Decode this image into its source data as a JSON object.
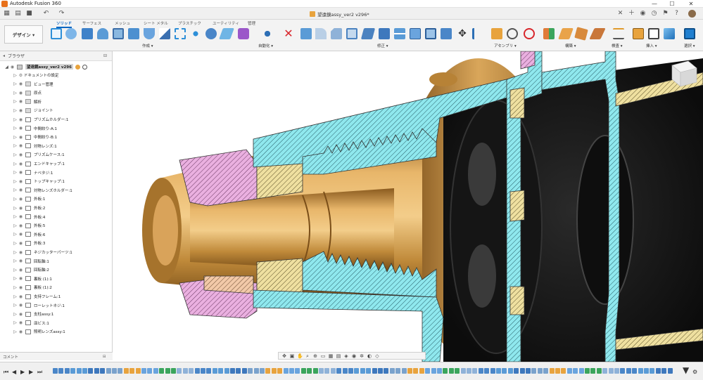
{
  "titlebar": {
    "app_title": "Autodesk Fusion 360",
    "minimize": "—",
    "maximize": "☐",
    "close": "✕"
  },
  "document": {
    "tab_title": "望遠鏡assy_ver2 v296*"
  },
  "workspace": {
    "design_label": "デザイン ▾"
  },
  "tabs": [
    {
      "label": "ソリッド",
      "active": true
    },
    {
      "label": "サーフェス"
    },
    {
      "label": "メッシュ"
    },
    {
      "label": "シート メタル"
    },
    {
      "label": "プラスチック"
    },
    {
      "label": "ユーティリティ"
    },
    {
      "label": "管理"
    }
  ],
  "groups": {
    "create": "作成 ▾",
    "automate": "自動化 ▾",
    "modify": "修正 ▾",
    "assemble": "アセンブリ ▾",
    "construct": "構築 ▾",
    "inspect": "検査 ▾",
    "insert": "挿入 ▾",
    "select": "選択 ▾"
  },
  "browser": {
    "title": "ブラウザ",
    "root": "望遠鏡assy_ver2 v296",
    "items": [
      {
        "label": "ドキュメントの設定",
        "kind": "gear"
      },
      {
        "label": "ビュー管理",
        "kind": "folder"
      },
      {
        "label": "原点",
        "kind": "folder"
      },
      {
        "label": "解析",
        "kind": "folder"
      },
      {
        "label": "ジョイント",
        "kind": "folder"
      },
      {
        "label": "プリズムホルダー:1",
        "kind": "comp"
      },
      {
        "label": "中間絞り-A:1",
        "kind": "comp"
      },
      {
        "label": "中間絞り-B:1",
        "kind": "comp"
      },
      {
        "label": "対物レンズ:1",
        "kind": "comp"
      },
      {
        "label": "プリズムケース:1",
        "kind": "comp"
      },
      {
        "label": "エンドキャップ:1",
        "kind": "comp"
      },
      {
        "label": "ナベタジ:1",
        "kind": "link"
      },
      {
        "label": "トップキャップ:1",
        "kind": "comp"
      },
      {
        "label": "対物レンズホルダー:1",
        "kind": "comp"
      },
      {
        "label": "外板:1",
        "kind": "comp"
      },
      {
        "label": "外板:2",
        "kind": "comp"
      },
      {
        "label": "外板:4",
        "kind": "comp"
      },
      {
        "label": "外板:5",
        "kind": "comp"
      },
      {
        "label": "外板:6",
        "kind": "comp"
      },
      {
        "label": "外板:3",
        "kind": "comp"
      },
      {
        "label": "ネジカッターパーツ:1",
        "kind": "link"
      },
      {
        "label": "回転軸:1",
        "kind": "comp"
      },
      {
        "label": "回転軸:2",
        "kind": "comp"
      },
      {
        "label": "裏板 (1):1",
        "kind": "comp"
      },
      {
        "label": "裏板 (1):2",
        "kind": "comp"
      },
      {
        "label": "支持フレーム:1",
        "kind": "comp"
      },
      {
        "label": "ローレットネジ:1",
        "kind": "comp"
      },
      {
        "label": "支柱assy:1",
        "kind": "link"
      },
      {
        "label": "皿ビス:1",
        "kind": "comp"
      },
      {
        "label": "照明レンズassy:1",
        "kind": "link"
      }
    ]
  },
  "comments": {
    "title": "コメント"
  },
  "colors": {
    "accent": "#0a66c2",
    "brass": "#c8923c",
    "section_cyan": "#8fe8ee",
    "section_pink": "#eab0e0",
    "section_yellow": "#efe0a0",
    "dark_body": "#1c1c1c"
  }
}
